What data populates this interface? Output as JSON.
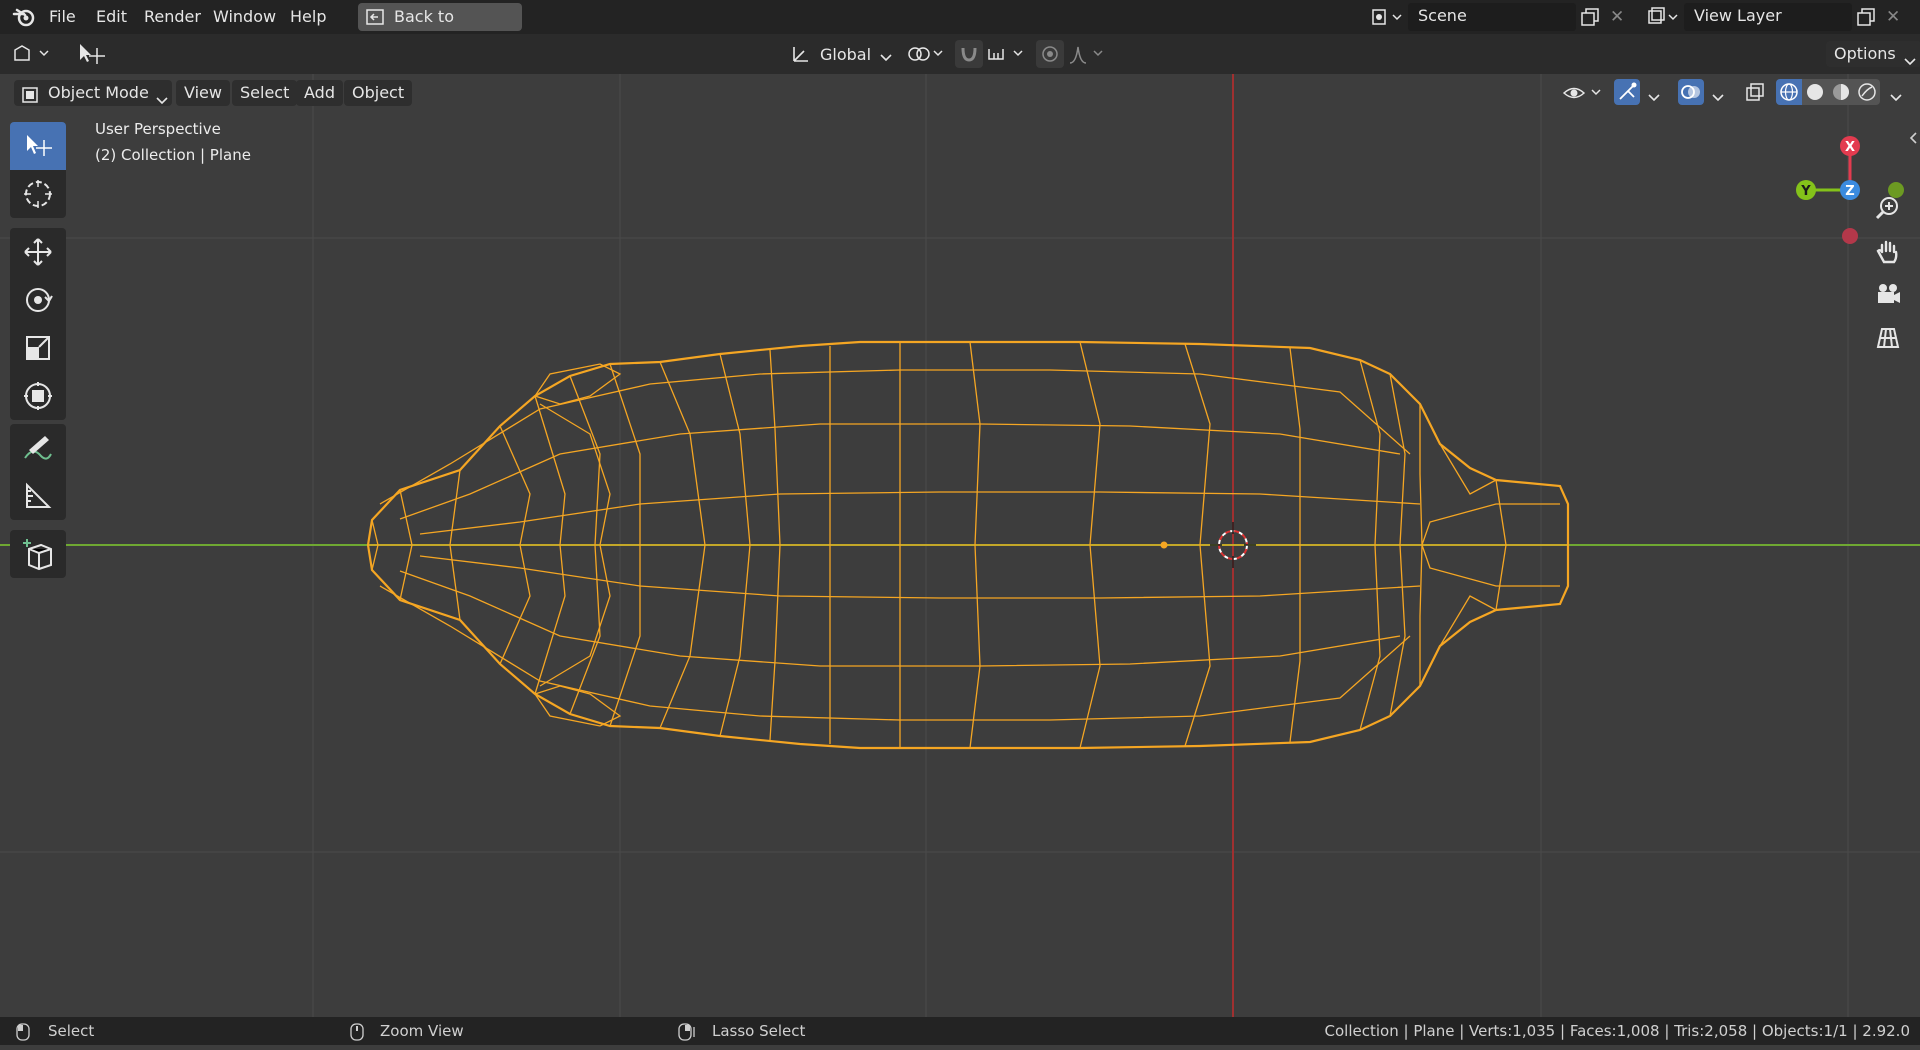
{
  "menubar": {
    "items": [
      "File",
      "Edit",
      "Render",
      "Window",
      "Help"
    ],
    "back_button": "Back to Previous",
    "scene_field": "Scene",
    "view_layer_field": "View Layer"
  },
  "tool_header": {
    "orientation": "Global",
    "options": "Options"
  },
  "viewport_header": {
    "mode": "Object Mode",
    "menus": [
      "View",
      "Select",
      "Add",
      "Object"
    ]
  },
  "viewport": {
    "perspective_label": "User Perspective",
    "collection_label": "(2) Collection | Plane",
    "gizmo": {
      "x": "X",
      "y": "Y",
      "z": "Z"
    }
  },
  "statusbar": {
    "select": "Select",
    "zoom": "Zoom View",
    "lasso": "Lasso Select",
    "stats": "Collection | Plane | Verts:1,035 | Faces:1,008 | Tris:2,058 | Objects:1/1 | 2.92.0"
  },
  "colors": {
    "wire": "#f5a623",
    "x_axis": "#a03030",
    "y_axis": "#6fa832",
    "active_tool": "#4772b3"
  }
}
